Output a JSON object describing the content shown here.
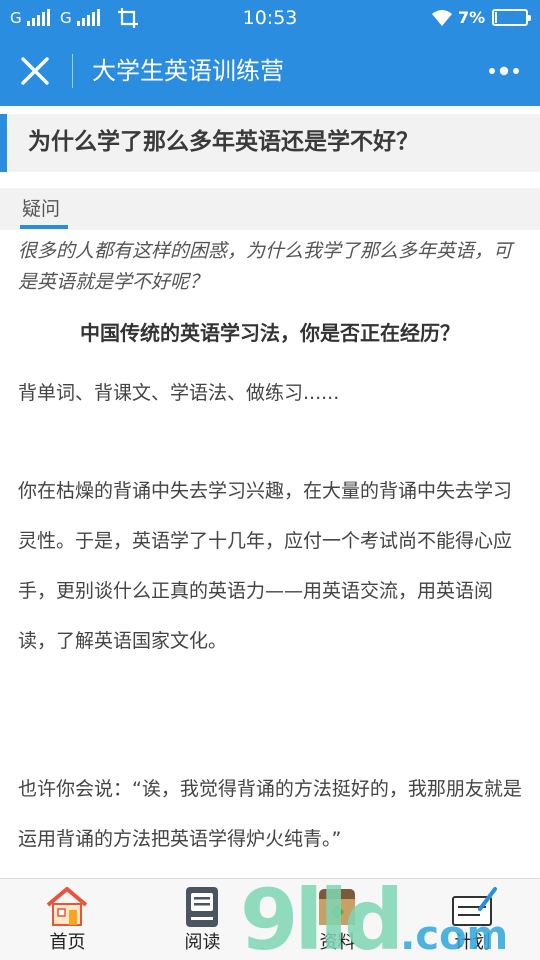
{
  "status_bar": {
    "carrier1": "G",
    "carrier2": "G",
    "time": "10:53",
    "battery_percent": "7%",
    "battery_level": 0.07,
    "icons": [
      "signal-icon",
      "signal-icon",
      "screenshot-icon",
      "wifi-icon",
      "battery-icon"
    ]
  },
  "app_bar": {
    "title": "大学生英语训练营",
    "close_icon": "close-icon",
    "more_icon": "more-icon"
  },
  "article": {
    "title": "为什么学了那么多年英语还是学不好？",
    "section_tag": "疑问",
    "intro": "很多的人都有这样的困惑，为什么我学了那么多年英语，可是英语就是学不好呢？",
    "subhead": "中国传统的英语学习法，你是否正在经历？",
    "paragraphs": [
      "背单词、背课文、学语法、做练习......",
      "你在枯燥的背诵中失去学习兴趣，在大量的背诵中失去学习灵性。于是，英语学了十几年，应付一个考试尚不能得心应手，更别谈什么正真的英语力——用英语交流，用英语阅读，了解英语国家文化。",
      "也许你会说：“诶，我觉得背诵的方法挺好的，我那朋友就是运用背诵的方法把英语学得炉火纯青。”"
    ]
  },
  "watermark": {
    "main": "9lld",
    "suffix": ".com"
  },
  "bottom_nav": {
    "items": [
      {
        "label": "首页",
        "icon": "home-icon"
      },
      {
        "label": "阅读",
        "icon": "book-icon"
      },
      {
        "label": "资料",
        "icon": "folder-icon"
      },
      {
        "label": "计划",
        "icon": "plan-icon"
      }
    ]
  },
  "colors": {
    "primary": "#2b8de0",
    "header_bg": "#f2f2f2",
    "text": "#444444"
  }
}
